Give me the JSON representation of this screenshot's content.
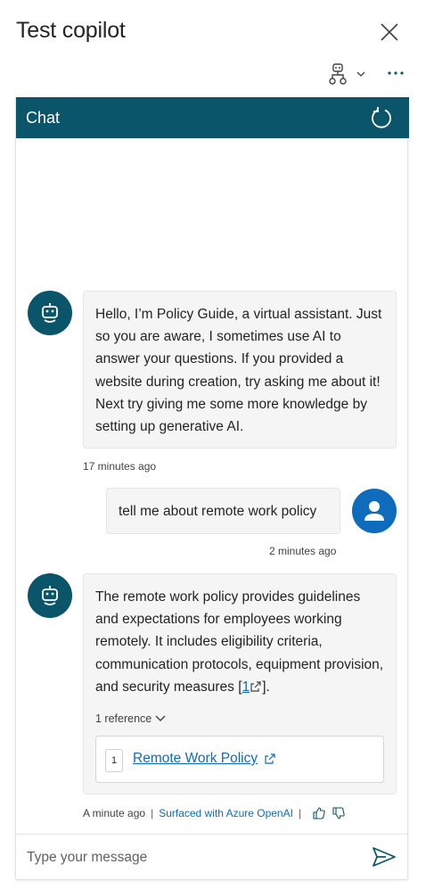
{
  "window": {
    "title": "Test copilot"
  },
  "chat": {
    "header_title": "Chat",
    "messages": [
      {
        "sender": "bot",
        "text": "Hello, I’m Policy Guide, a virtual assistant. Just so you are aware, I sometimes use AI to answer your questions. If you provided a website during creation, try asking me about it! Next try giving me some more knowledge by setting up generative AI.",
        "timestamp": "17 minutes ago"
      },
      {
        "sender": "user",
        "text": "tell me about remote work policy",
        "timestamp": "2 minutes ago"
      },
      {
        "sender": "bot",
        "text": "The remote work policy provides guidelines and expectations for employees working remotely. It includes eligibility criteria, communication protocols, equipment provision, and security measures ",
        "citation": "1",
        "text_end": "].",
        "timestamp": "A minute ago",
        "source_label": "Surfaced with Azure OpenAI",
        "references_label": "1 reference",
        "references": [
          {
            "number": "1",
            "title": "Remote Work Policy"
          }
        ]
      }
    ],
    "composer_placeholder": "Type your message"
  },
  "colors": {
    "header": "#0b556a",
    "user_avatar": "#0f6cbd",
    "link": "#0f6cbd",
    "bubble": "#f5f5f5"
  },
  "icons": [
    "close-icon",
    "topic-tree-icon",
    "chevron-down-icon",
    "more-icon",
    "refresh-icon",
    "bot-icon",
    "user-icon",
    "external-link-icon",
    "thumbs-up-icon",
    "thumbs-down-icon",
    "send-icon"
  ]
}
